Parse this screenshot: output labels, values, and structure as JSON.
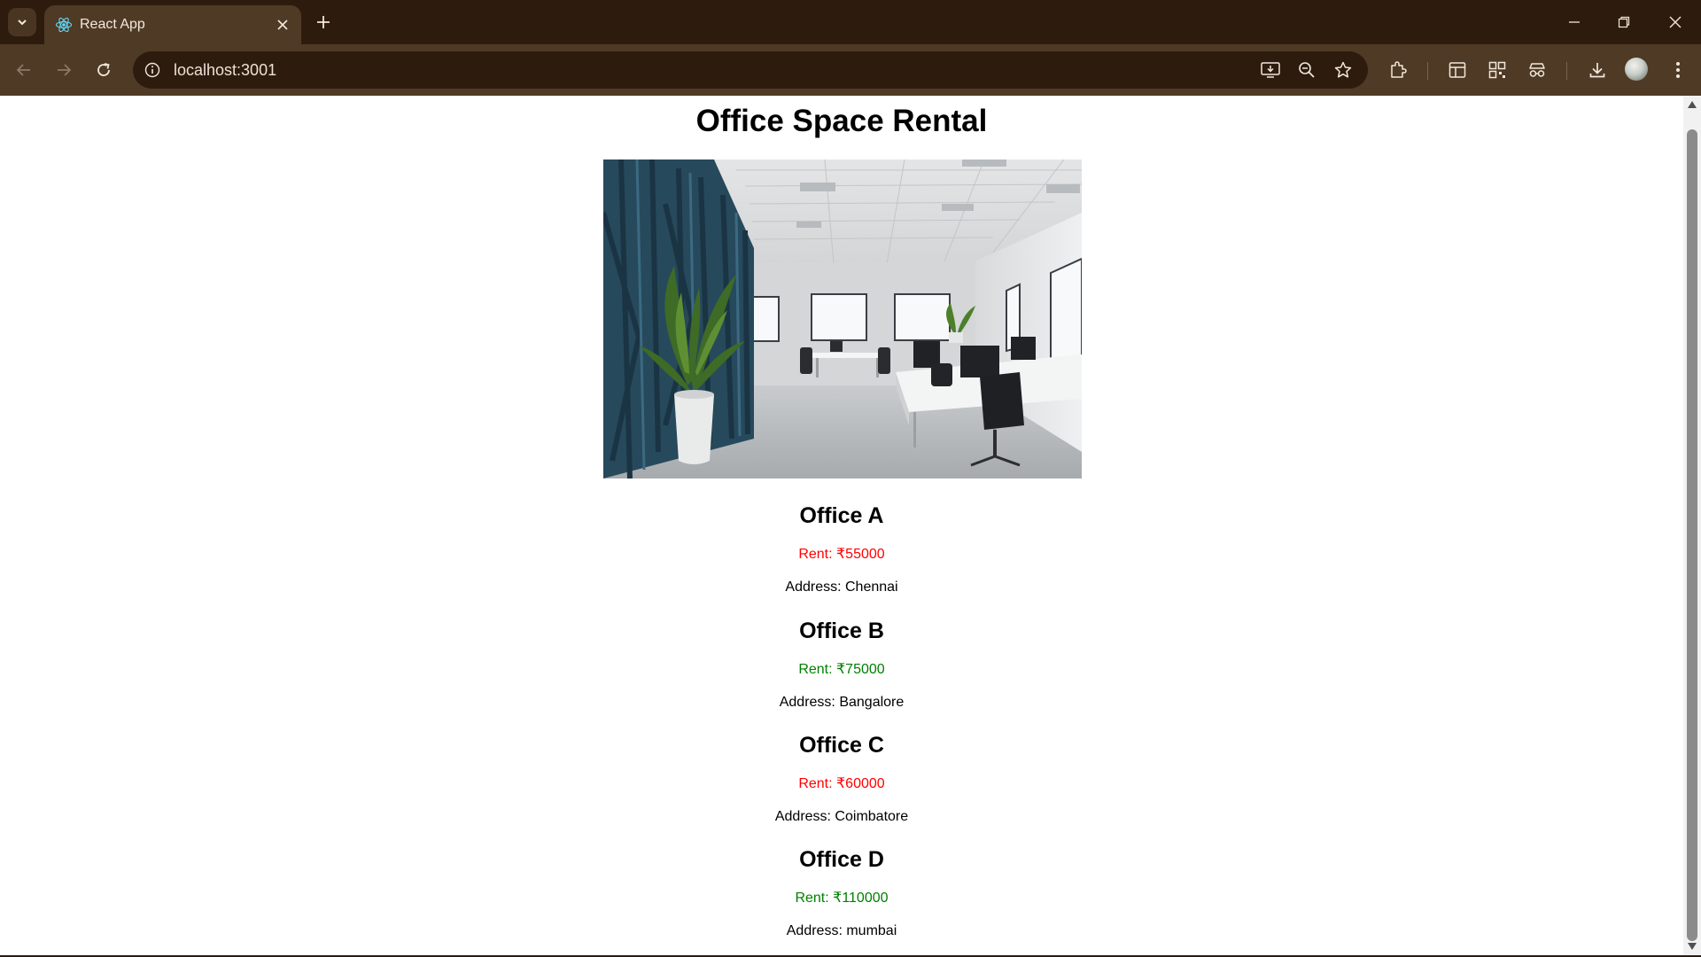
{
  "browser": {
    "tab_title": "React App",
    "url": "localhost:3001",
    "theme_color": "#2d1c0e",
    "toolbar_color": "#4f3a25",
    "icons": [
      "tab-search-icon",
      "react-favicon-icon",
      "close-icon",
      "plus-icon",
      "minimize-icon",
      "restore-icon",
      "window-close-icon",
      "back-icon",
      "forward-icon",
      "reload-icon",
      "site-info-icon",
      "install-app-icon",
      "zoom-icon",
      "bookmark-star-icon",
      "extensions-icon",
      "side-panel-icon",
      "qr-code-icon",
      "incognito-glasses-icon",
      "download-icon",
      "profile-avatar",
      "more-menu-icon"
    ]
  },
  "page": {
    "title": "Office Space Rental",
    "hero_image_alt": "Open-plan office interior",
    "offices": [
      {
        "name": "Office A",
        "rent": "Rent: ₹55000",
        "address": "Address: Chennai",
        "rent_color": "#ff0000"
      },
      {
        "name": "Office B",
        "rent": "Rent: ₹75000",
        "address": "Address: Bangalore",
        "rent_color": "#008000"
      },
      {
        "name": "Office C",
        "rent": "Rent: ₹60000",
        "address": "Address: Coimbatore",
        "rent_color": "#ff0000"
      },
      {
        "name": "Office D",
        "rent": "Rent: ₹110000",
        "address": "Address: mumbai",
        "rent_color": "#008000"
      }
    ]
  }
}
